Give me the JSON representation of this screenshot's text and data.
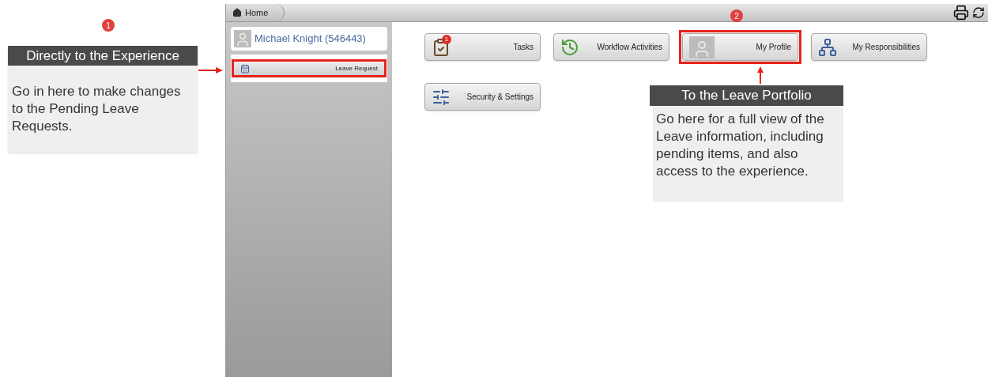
{
  "breadcrumb": {
    "label": "Home"
  },
  "user": {
    "name": "Michael Knight (546443)"
  },
  "sidebar": {
    "items": [
      {
        "label": "Leave Request",
        "highlighted": true
      }
    ]
  },
  "tiles": [
    {
      "label": "Tasks",
      "kind": "tasks",
      "badge": "1",
      "highlighted": false
    },
    {
      "label": "Workflow Activities",
      "kind": "workflow",
      "highlighted": false
    },
    {
      "label": "My Profile",
      "kind": "profile",
      "highlighted": true
    },
    {
      "label": "My Responsibilities",
      "kind": "responsibilities",
      "highlighted": false
    },
    {
      "label": "Security & Settings",
      "kind": "settings",
      "highlighted": false
    }
  ],
  "annotations": [
    {
      "number": "1",
      "title": "Directly to the Experience",
      "text": "Go in here to make changes to the Pending Leave Requests."
    },
    {
      "number": "2",
      "title": "To the Leave Portfolio",
      "text": "Go here for a full view of the Leave information, including pending items, and also access to the experience."
    }
  ]
}
